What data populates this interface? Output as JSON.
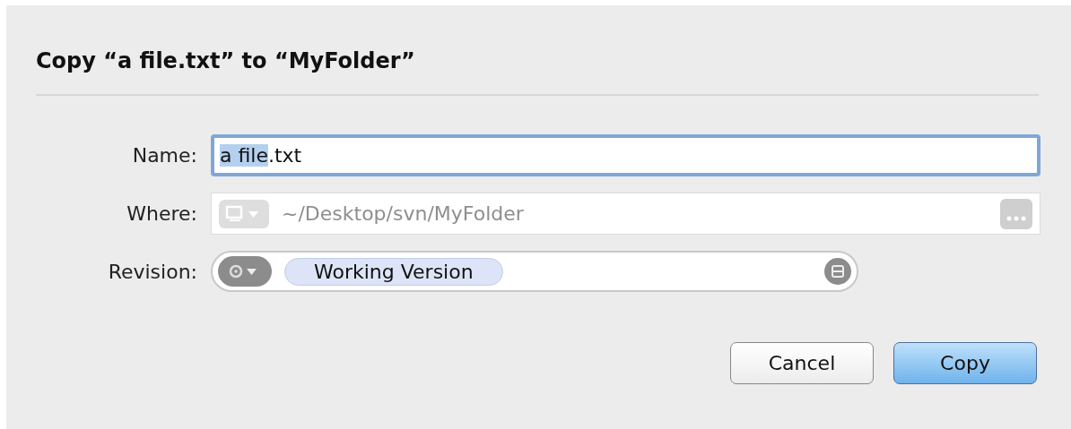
{
  "dialog": {
    "title": "Copy “a file.txt” to “MyFolder”"
  },
  "fields": [
    {
      "kind": "text",
      "label": "Name:",
      "focused": true,
      "disabled": false,
      "value_parts": [
        {
          "text": "a file",
          "selected": true
        },
        {
          "text": ".txt",
          "selected": false
        }
      ]
    },
    {
      "kind": "path",
      "label": "Where:",
      "focused": false,
      "disabled": true,
      "value": "~/Desktop/svn/MyFolder"
    },
    {
      "kind": "token",
      "label": "Revision:",
      "focused": false,
      "disabled": false,
      "token": "Working Version"
    }
  ],
  "buttons": [
    {
      "label": "Cancel",
      "default": false
    },
    {
      "label": "Copy",
      "default": true
    }
  ]
}
